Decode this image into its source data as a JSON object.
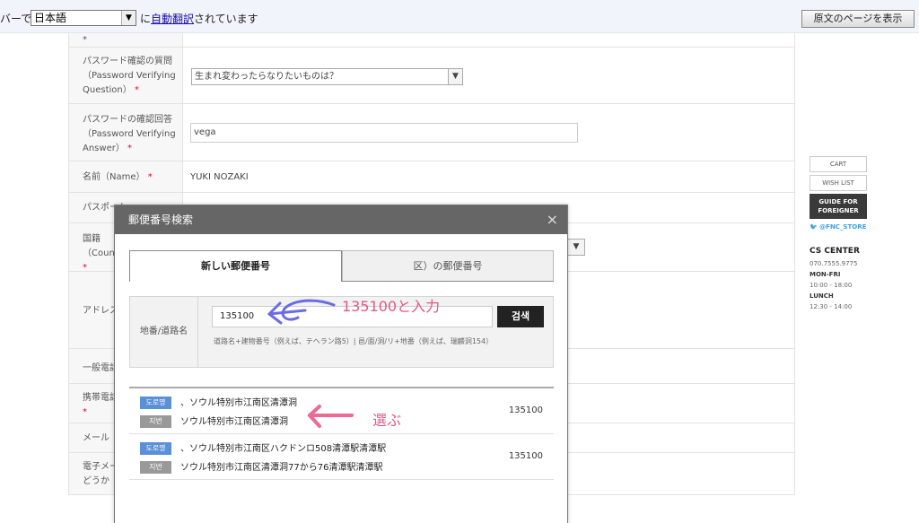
{
  "translate_bar": {
    "prefix": "バーで",
    "language": "日本語",
    "suffix_pre": "に",
    "link": "自動翻訳",
    "suffix_post": "されています",
    "show_original": "原文のページを表示"
  },
  "form": {
    "rows": [
      {
        "label": "パスワード確認の質問\n（Password Verifying\nQuestion）",
        "value": "生まれ変わったらなりたいものは？"
      },
      {
        "label": "パスワードの確認回答\n（Password Verifying\nAnswer）",
        "value": "vega"
      },
      {
        "label": "名前（Name）",
        "value": "YUKI NOZAKI"
      },
      {
        "label": "パスポート"
      },
      {
        "label": "国籍\n（Coun"
      },
      {
        "label": "アドレス"
      },
      {
        "label": "一般電話"
      },
      {
        "label": "携帯電話"
      },
      {
        "label": "メール"
      },
      {
        "label": "電子メー\nどうか"
      }
    ]
  },
  "side": {
    "cart": "CART",
    "wishlist": "WISH LIST",
    "guide": "GUIDE FOR\nFOREIGNER",
    "twitter": "@FNC_STORE",
    "cs_title": "CS CENTER",
    "phone": "070.7555.9775",
    "days": "MON-FRI",
    "hours": "10:00 - 18:00",
    "lunch_label": "LUNCH",
    "lunch": "12:30 - 14:00"
  },
  "modal": {
    "title": "郵便番号検索",
    "close": "×",
    "tabs": [
      "新しい郵便番号",
      "区）の郵便番号"
    ],
    "search_label": "地番/道路名",
    "search_value": "135100",
    "search_button": "검색",
    "hint": "道路名+建物番号（例えば、テヘラン路5）| 邑/面/洞/リ+地番（例えば、瑞麟洞154）",
    "results": [
      {
        "road_badge": "도로명",
        "road": "、ソウル特別市江南区清潭洞",
        "lot_badge": "지번",
        "lot": "ソウル特別市江南区清潭洞",
        "zip": "135100"
      },
      {
        "road_badge": "도로명",
        "road": "、ソウル特別市江南区ハクドンロ508清潭駅清潭駅",
        "lot_badge": "지번",
        "lot": "ソウル特別市江南区清潭洞77から76清潭駅清潭駅",
        "zip": "135100"
      }
    ]
  },
  "annotations": {
    "enter": "135100と入力",
    "choose": "選ぶ",
    "arrow1_color": "#6a6de0",
    "arrow2_color": "#ec6a93"
  }
}
